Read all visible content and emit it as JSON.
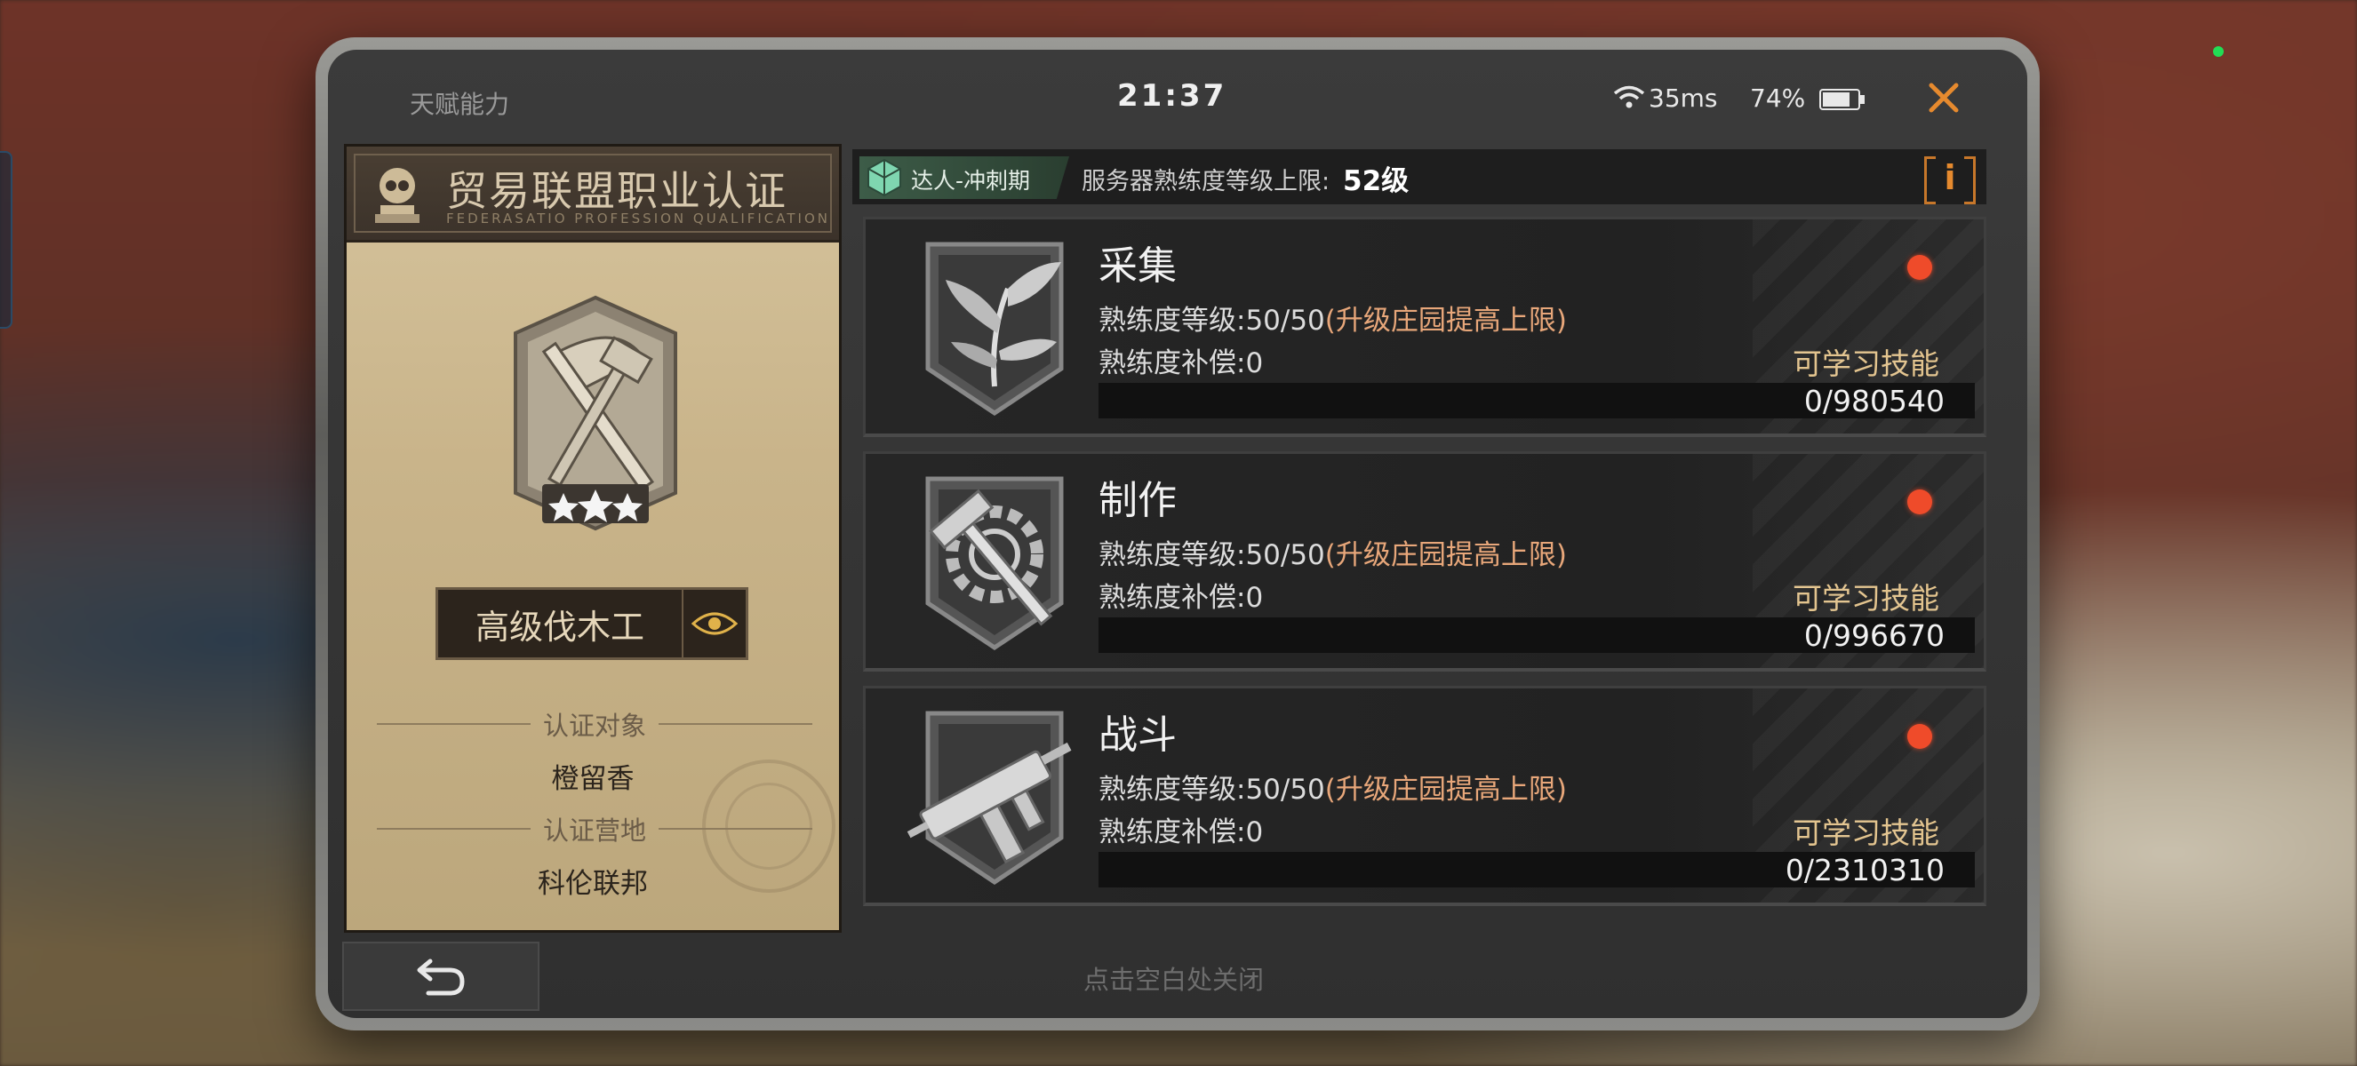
{
  "status": {
    "app_title": "天赋能力",
    "time": "21:37",
    "ping": "35ms",
    "battery": "74%"
  },
  "certification": {
    "title": "贸易联盟职业认证",
    "subtitle": "FEDERASATIO PROFESSION QUALIFICATION",
    "profession": "高级伐木工",
    "stars": 3,
    "subject_label": "认证对象",
    "subject_value": "橙留香",
    "camp_label": "认证营地",
    "camp_value": "科伦联邦"
  },
  "tier": {
    "label": "达人-冲刺期",
    "server_label": "服务器熟练度等级上限:",
    "server_value": "52级",
    "info_label": "i"
  },
  "skills": [
    {
      "name": "采集",
      "level_text": "熟练度等级:50/50",
      "level_hint": "(升级庄园提高上限)",
      "compensation": "熟练度补偿:0",
      "learn_label": "可学习技能",
      "progress_text": "0/980540",
      "progress": 0,
      "icon": "leaves-icon"
    },
    {
      "name": "制作",
      "level_text": "熟练度等级:50/50",
      "level_hint": "(升级庄园提高上限)",
      "compensation": "熟练度补偿:0",
      "learn_label": "可学习技能",
      "progress_text": "0/996670",
      "progress": 0,
      "icon": "gear-hammer-icon"
    },
    {
      "name": "战斗",
      "level_text": "熟练度等级:50/50",
      "level_hint": "(升级庄园提高上限)",
      "compensation": "熟练度补偿:0",
      "learn_label": "可学习技能",
      "progress_text": "0/2310310",
      "progress": 0,
      "icon": "smg-icon"
    }
  ],
  "footer": {
    "close_hint": "点击空白处关闭"
  },
  "colors": {
    "accent": "#e68a2e",
    "notify": "#ef4b2a",
    "hint": "#e8a77a"
  }
}
